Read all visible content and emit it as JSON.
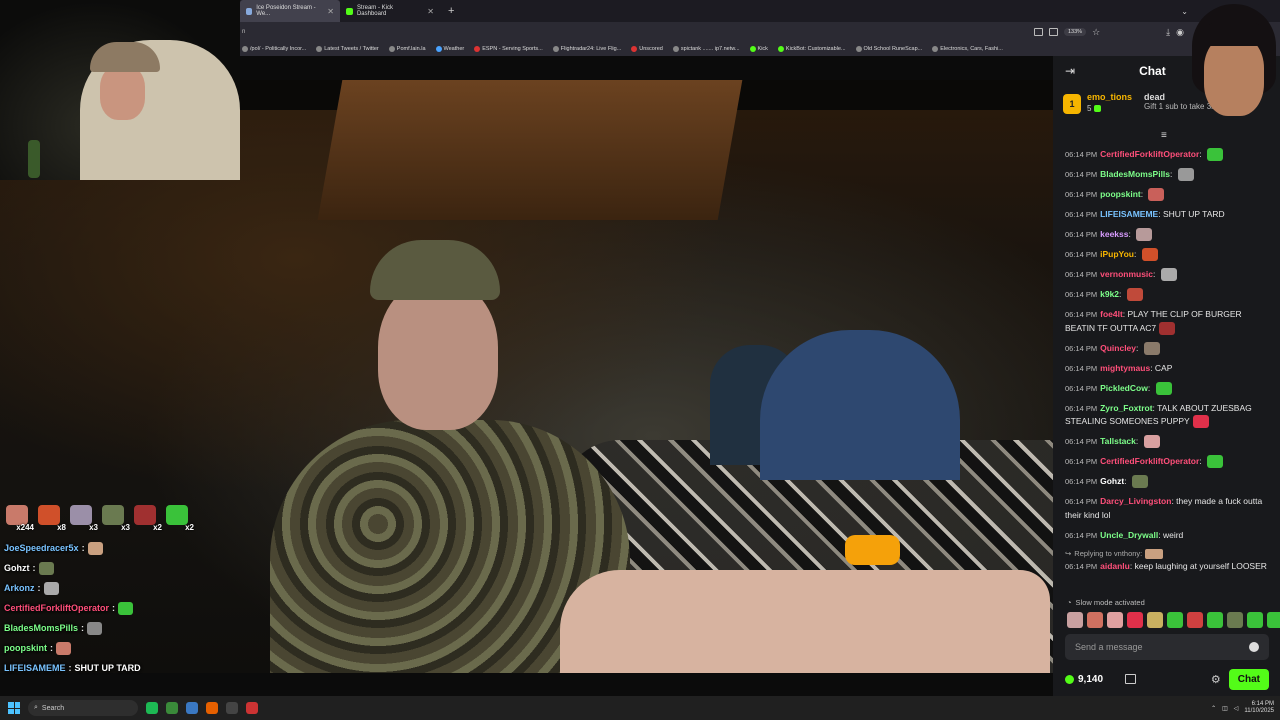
{
  "browser": {
    "tabs": [
      {
        "label": "Ice Poseidon Stream - We...",
        "active": true
      },
      {
        "label": "Stream - Kick Dashboard",
        "active": false
      }
    ],
    "new_tab": "+",
    "url_partial": "n",
    "zoom": "133%",
    "bookmarks": [
      "/pol/ - Politically Incor...",
      "Latest Tweets / Twitter",
      "Pomf.lain.la",
      "Weather",
      "ESPN - Serving Sports...",
      "Flightradar24: Live Flig...",
      "Unscored",
      "spictank ....... ip7.netw...",
      "Kick",
      "KickBot: Customizable...",
      "Old School RuneScap...",
      "Electronics, Cars, Fashi..."
    ]
  },
  "overlay": {
    "emote_tray": [
      {
        "count": "x244",
        "color": "#c97a6a"
      },
      {
        "count": "x8",
        "color": "#d0502a"
      },
      {
        "count": "x3",
        "color": "#9b8fa8"
      },
      {
        "count": "x3",
        "color": "#6a7a50"
      },
      {
        "count": "x2",
        "color": "#a03030"
      },
      {
        "count": "x2",
        "color": "#3ac23a"
      }
    ],
    "chat": [
      {
        "user": "JoeSpeedracer5x",
        "color": "#79c3ff",
        "text": "",
        "emote": "#c9a080"
      },
      {
        "user": "Gohzt",
        "color": "#ffffff",
        "text": "",
        "emote": "#6a7a50"
      },
      {
        "user": "Arkonz",
        "color": "#79c3ff",
        "text": "",
        "emote": "#aaaaaa"
      },
      {
        "user": "CertifiedForkliftOperator",
        "color": "#ff4f7a",
        "text": "",
        "emote": "#3ac23a"
      },
      {
        "user": "BladesMomsPills",
        "color": "#7dff8a",
        "text": "",
        "emote": "#888888"
      },
      {
        "user": "poopskint",
        "color": "#7dff8a",
        "text": "",
        "emote": "#c97a6a"
      },
      {
        "user": "LIFEISAMEME",
        "color": "#79c3ff",
        "text": "SHUT UP TARD",
        "emote": ""
      }
    ]
  },
  "chat_panel": {
    "title": "Chat",
    "pinned": {
      "rank": "1",
      "user": "emo_tions",
      "count": "5",
      "right_user": "dead",
      "right_text": "Gift 1 sub to take 3rd"
    },
    "messages": [
      {
        "time": "06:14 PM",
        "user": "CertifiedForkliftOperator",
        "color": "#ff4f7a",
        "text": "",
        "emote": "#3ac23a"
      },
      {
        "time": "06:14 PM",
        "user": "BladesMomsPills",
        "color": "#7dff8a",
        "text": "",
        "emote": "#999999"
      },
      {
        "time": "06:14 PM",
        "user": "poopskint",
        "color": "#7dff8a",
        "text": "",
        "emote": "#c9605a"
      },
      {
        "time": "06:14 PM",
        "user": "LIFEISAMEME",
        "color": "#79c3ff",
        "text": "SHUT UP TARD",
        "emote": ""
      },
      {
        "time": "06:14 PM",
        "user": "keekss",
        "color": "#d99cff",
        "text": "",
        "emote": "#b79a9a"
      },
      {
        "time": "06:14 PM",
        "user": "iPupYou",
        "color": "#f6b500",
        "text": "",
        "emote": "#d0502a"
      },
      {
        "time": "06:14 PM",
        "user": "vernonmusic",
        "color": "#ff4f7a",
        "text": "",
        "emote": "#aaaaaa"
      },
      {
        "time": "06:14 PM",
        "user": "k9k2",
        "color": "#7dff8a",
        "text": "",
        "emote": "#c04a3a"
      },
      {
        "time": "06:14 PM",
        "user": "foe4lt",
        "color": "#ff4f7a",
        "text": "PLAY THE CLIP OF BURGER BEATIN TF OUTTA AC7",
        "emote": "#a03030"
      },
      {
        "time": "06:14 PM",
        "user": "Quincley",
        "color": "#ff4f7a",
        "text": "",
        "emote": "#8a7a6a"
      },
      {
        "time": "06:14 PM",
        "user": "mightymaus",
        "color": "#ff4f7a",
        "text": "CAP",
        "emote": ""
      },
      {
        "time": "06:14 PM",
        "user": "PickledCow",
        "color": "#7dff8a",
        "text": "",
        "emote": "#3ac23a"
      },
      {
        "time": "06:14 PM",
        "user": "Zyro_Foxtrot",
        "color": "#7dff8a",
        "text": "TALK ABOUT ZUESBAG STEALING SOMEONES PUPPY",
        "emote": "#e0304a"
      },
      {
        "time": "06:14 PM",
        "user": "Tallstack",
        "color": "#7dff8a",
        "text": "",
        "emote": "#d9a0a0"
      },
      {
        "time": "06:14 PM",
        "user": "CertifiedForkliftOperator",
        "color": "#ff4f7a",
        "text": "",
        "emote": "#3ac23a"
      },
      {
        "time": "06:14 PM",
        "user": "Gohzt",
        "color": "#ffffff",
        "text": "",
        "emote": "#6a7a50"
      },
      {
        "time": "06:14 PM",
        "user": "Darcy_Livingston",
        "color": "#ff4f7a",
        "text": "they made a fuck outta their kind lol",
        "emote": ""
      },
      {
        "time": "06:14 PM",
        "user": "Uncle_Drywall",
        "color": "#7dff8a",
        "text": "weird",
        "emote": ""
      }
    ],
    "reply": {
      "label": "Replying to vnthony:",
      "time": "06:14 PM",
      "user": "aidanlu",
      "color": "#ff4f7a",
      "text": "keep laughing at yourself LOOSER"
    },
    "slow_mode": "Slow mode activated",
    "quick_emotes": [
      "#c9a0a0",
      "#d07060",
      "#e0a0a0",
      "#e0304a",
      "#c9b060",
      "#3ac23a",
      "#d04040",
      "#3ac23a",
      "#6a7a50",
      "#3ac23a",
      "#3ac23a"
    ],
    "input_placeholder": "Send a message",
    "points": "9,140",
    "chat_button": "Chat"
  },
  "taskbar": {
    "search": "Search",
    "time": "6:14 PM",
    "date": "11/10/2025"
  }
}
